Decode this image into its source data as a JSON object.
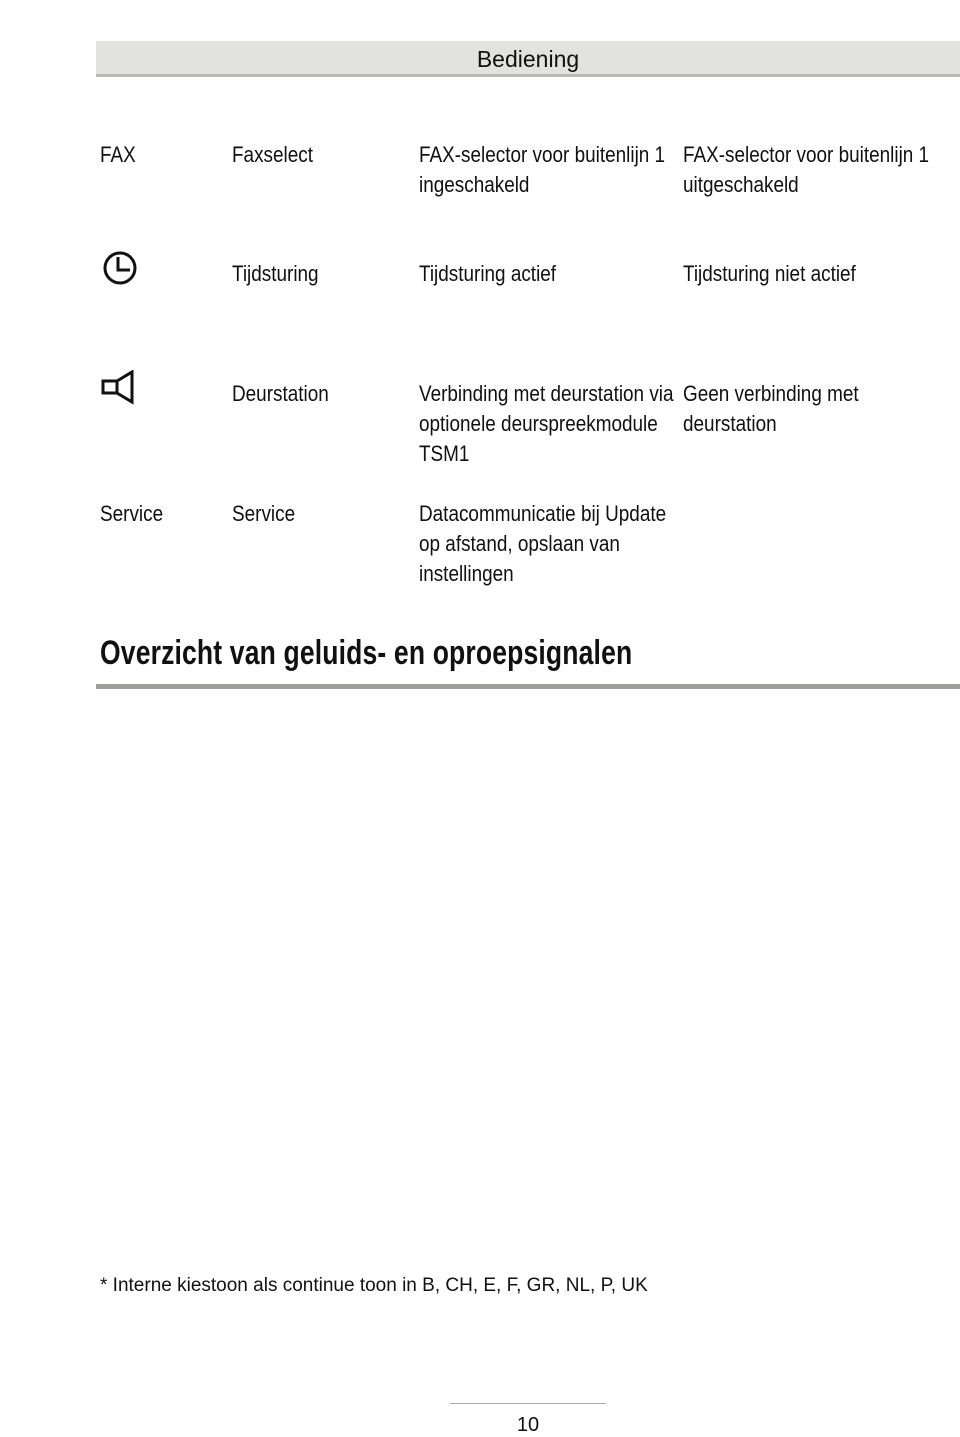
{
  "header": {
    "title": "Bediening"
  },
  "table": {
    "rows": [
      {
        "symbol": "FAX",
        "symbol_icon": null,
        "function": "Faxselect",
        "on_lines": [
          "FAX-selector voor buitenlijn 1",
          "ingeschakeld"
        ],
        "off_lines": [
          "FAX-selector voor buitenlijn 1",
          "uitgeschakeld"
        ]
      },
      {
        "symbol": "",
        "symbol_icon": "clock-icon",
        "function": "Tijdsturing",
        "on_lines": [
          "Tijdsturing actief"
        ],
        "off_lines": [
          "Tijdsturing niet actief"
        ]
      },
      {
        "symbol": "",
        "symbol_icon": "speaker-icon",
        "function": "Deurstation",
        "on_lines": [
          "Verbinding met deurstation via",
          "optionele deurspreekmodule",
          "TSM1"
        ],
        "off_lines": [
          "Geen verbinding met",
          "deurstation"
        ]
      },
      {
        "symbol": "Service",
        "symbol_icon": null,
        "function": "Service",
        "on_lines": [
          "Datacommunicatie bij Update",
          "op afstand, opslaan van",
          "instellingen"
        ],
        "off_lines": []
      }
    ]
  },
  "section": {
    "title": "Overzicht van geluids- en oproepsignalen"
  },
  "footnote": "* Interne kiestoon als continue toon in B, CH, E, F, GR, NL, P, UK",
  "page_number": "10"
}
